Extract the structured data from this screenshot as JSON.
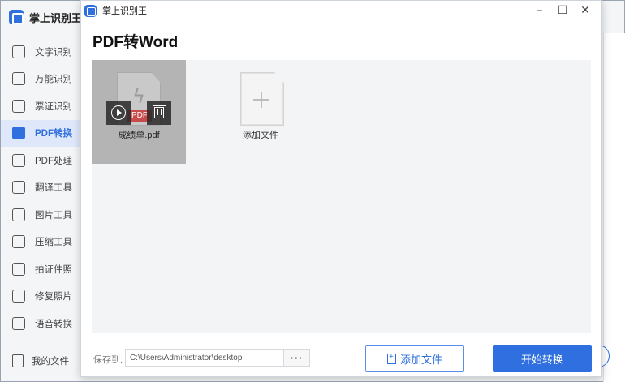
{
  "app": {
    "title": "掌上识别王"
  },
  "sidebar": {
    "items": [
      {
        "label": "文字识别",
        "icon": "text-recognition-icon"
      },
      {
        "label": "万能识别",
        "icon": "universal-recognition-icon"
      },
      {
        "label": "票证识别",
        "icon": "ticket-recognition-icon"
      },
      {
        "label": "PDF转换",
        "icon": "pdf-convert-icon",
        "active": true
      },
      {
        "label": "PDF处理",
        "icon": "pdf-process-icon"
      },
      {
        "label": "翻译工具",
        "icon": "translate-icon"
      },
      {
        "label": "图片工具",
        "icon": "image-tool-icon"
      },
      {
        "label": "压缩工具",
        "icon": "compress-icon"
      },
      {
        "label": "拍证件照",
        "icon": "id-photo-icon"
      },
      {
        "label": "修复照片",
        "icon": "photo-repair-icon"
      },
      {
        "label": "语音转换",
        "icon": "voice-convert-icon"
      }
    ],
    "bottom": {
      "label": "我的文件",
      "icon": "my-files-icon"
    }
  },
  "dialog": {
    "title": "掌上识别王",
    "heading": "PDF转Word",
    "window_buttons": {
      "minimize": "–",
      "maximize": "☐",
      "close": "✕"
    },
    "files": [
      {
        "name": "成绩单.pdf",
        "tag": "PDF"
      }
    ],
    "add_card_label": "添加文件",
    "save_label": "保存到:",
    "save_path": "C:\\Users\\Administrator\\desktop",
    "browse_label": "···",
    "add_file_button": "添加文件",
    "start_button": "开始转换"
  },
  "colors": {
    "accent": "#2f6fdf",
    "pdf_tag": "#c94a4a",
    "selected_card": "#b4b4b4"
  }
}
